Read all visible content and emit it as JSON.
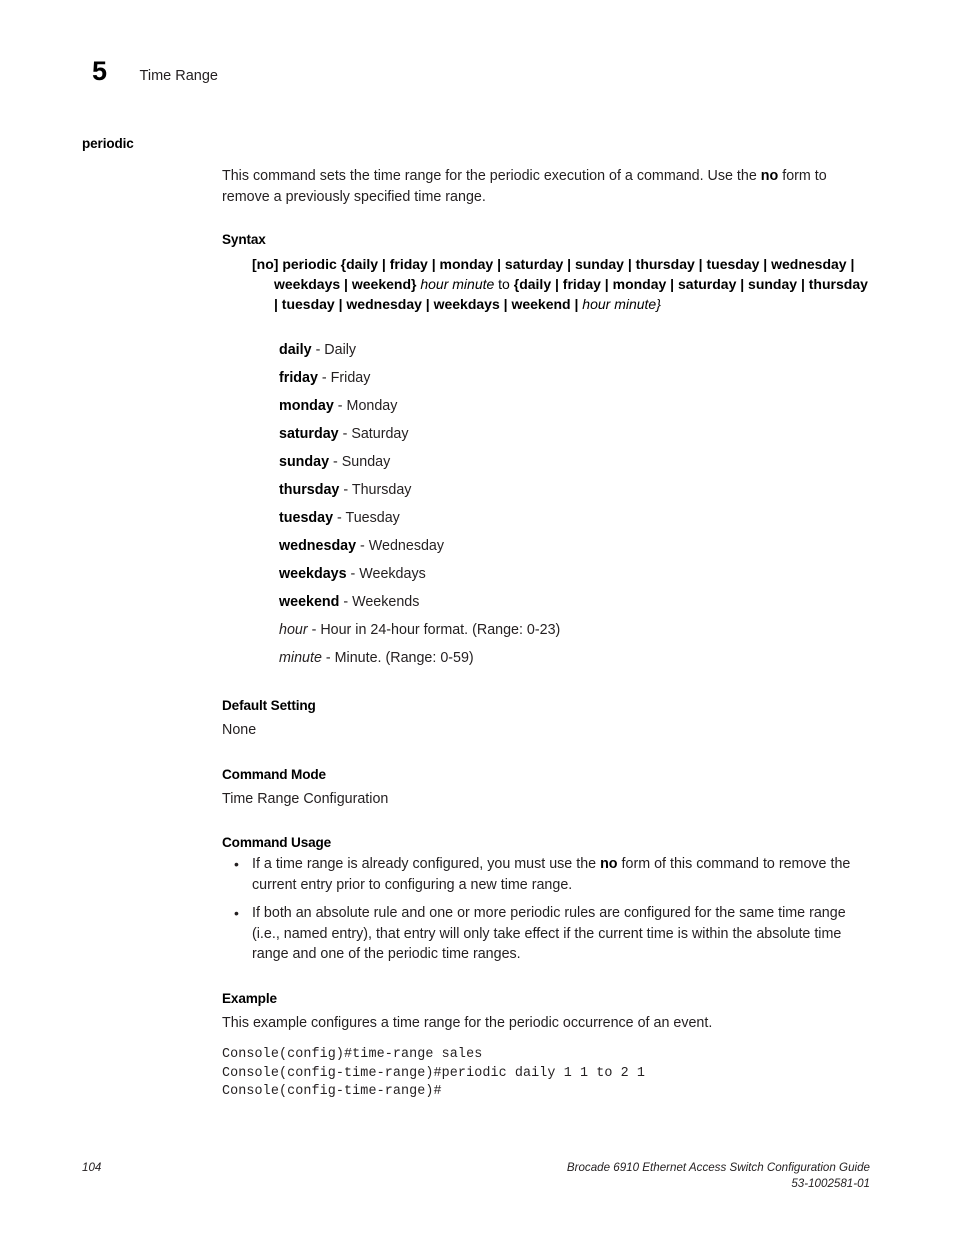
{
  "header": {
    "chapter_number": "5",
    "chapter_title": "Time Range"
  },
  "command": {
    "name": "periodic",
    "description_part1": "This command sets the time range for the periodic execution of a command. Use the ",
    "description_keyword": "no",
    "description_part2": " form to remove a previously specified time range."
  },
  "sections": {
    "syntax_heading": "Syntax",
    "default_setting_heading": "Default Setting",
    "default_setting_value": "None",
    "command_mode_heading": "Command Mode",
    "command_mode_value": "Time Range Configuration",
    "command_usage_heading": "Command Usage",
    "example_heading": "Example",
    "example_intro": "This example configures a time range for the periodic occurrence of an event."
  },
  "syntax": {
    "line1": "[no] periodic {daily | friday | monday | saturday | sunday | thursday | tuesday | wednesday |",
    "line2_lit_a": "weekdays | weekend}",
    "line2_var": "hour minute",
    "line2_plain": "to",
    "line2_lit_b": "{daily | friday | monday | saturday | sunday |",
    "line3_lit": "thursday | tuesday | wednesday | weekdays | weekend |",
    "line3_var": "hour minute}"
  },
  "parameters": [
    {
      "keyword": "daily",
      "italic": false,
      "description": " - Daily"
    },
    {
      "keyword": "friday",
      "italic": false,
      "description": " - Friday"
    },
    {
      "keyword": "monday",
      "italic": false,
      "description": " - Monday"
    },
    {
      "keyword": "saturday",
      "italic": false,
      "description": " - Saturday"
    },
    {
      "keyword": "sunday",
      "italic": false,
      "description": " - Sunday"
    },
    {
      "keyword": "thursday",
      "italic": false,
      "description": " - Thursday"
    },
    {
      "keyword": "tuesday",
      "italic": false,
      "description": " - Tuesday"
    },
    {
      "keyword": "wednesday",
      "italic": false,
      "description": " - Wednesday"
    },
    {
      "keyword": "weekdays",
      "italic": false,
      "description": " - Weekdays"
    },
    {
      "keyword": "weekend",
      "italic": false,
      "description": " - Weekends"
    },
    {
      "keyword": "hour",
      "italic": true,
      "description": " - Hour in 24-hour format. (Range: 0-23)"
    },
    {
      "keyword": "minute",
      "italic": true,
      "description": " - Minute. (Range: 0-59)"
    }
  ],
  "usage_notes": [
    {
      "bullet": "•",
      "text_part1": "If a time range is already configured, you must use the ",
      "keyword": "no",
      "text_part2": " form of this command to remove the current entry prior to configuring a new time range."
    },
    {
      "bullet": "•",
      "text_part1": "If both an absolute rule and one or more periodic rules are configured for the same time range (i.e., named entry), that entry will only take effect if the current time is within the absolute time range and one of the periodic time ranges.",
      "keyword": "",
      "text_part2": ""
    }
  ],
  "example_code": "Console(config)#time-range sales\nConsole(config-time-range)#periodic daily 1 1 to 2 1\nConsole(config-time-range)#",
  "footer": {
    "page_number": "104",
    "document_title": "Brocade 6910 Ethernet Access Switch Configuration Guide",
    "document_id": "53-1002581-01"
  }
}
